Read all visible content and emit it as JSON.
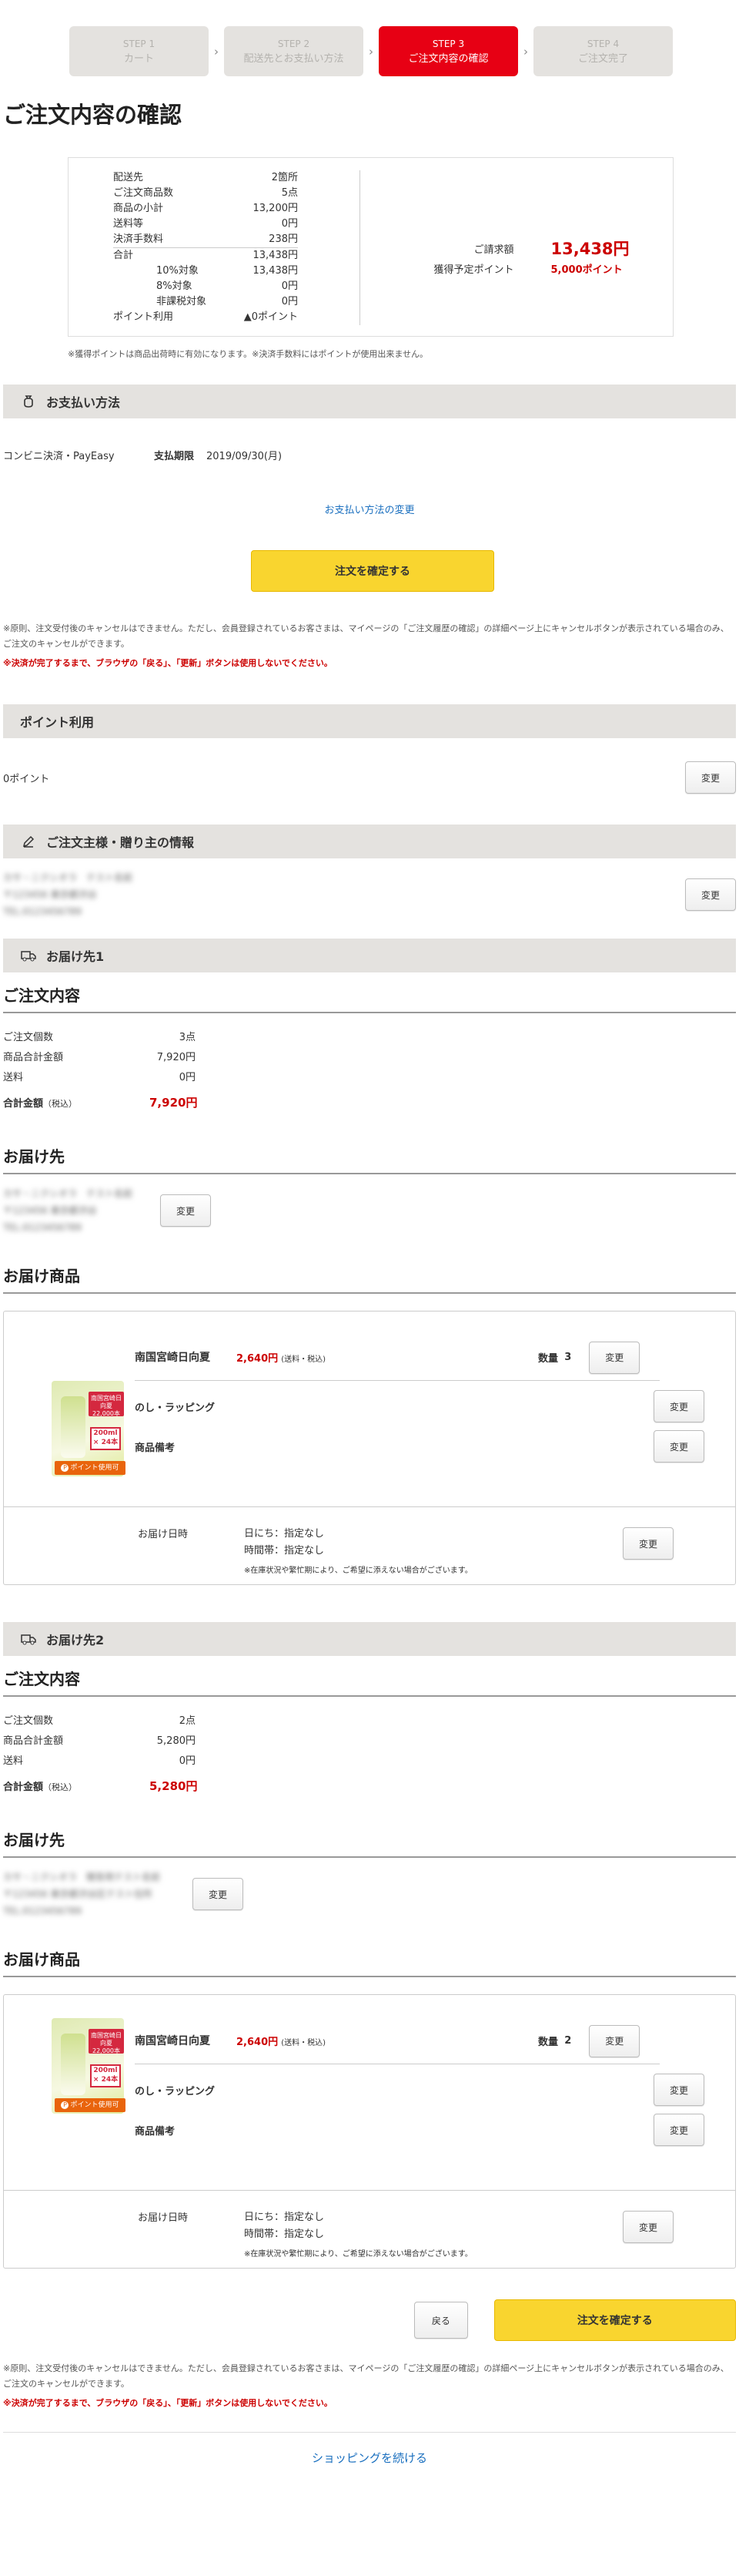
{
  "steps": [
    {
      "num": "STEP 1",
      "label": "カート"
    },
    {
      "num": "STEP 2",
      "label": "配送先とお支払い方法"
    },
    {
      "num": "STEP 3",
      "label": "ご注文内容の確認"
    },
    {
      "num": "STEP 4",
      "label": "ご注文完了"
    }
  ],
  "step_sep": "›",
  "page_title": "ご注文内容の確認",
  "summary": {
    "rows": [
      {
        "k": "配送先",
        "v": "2箇所"
      },
      {
        "k": "ご注文商品数",
        "v": "5点"
      },
      {
        "k": "商品の小計",
        "v": "13,200円"
      },
      {
        "k": "送料等",
        "v": "0円"
      },
      {
        "k": "決済手数料",
        "v": "238円"
      },
      {
        "k": "合計",
        "v": "13,438円"
      },
      {
        "k": "10%対象",
        "v": "13,438円"
      },
      {
        "k": "8%対象",
        "v": "0円"
      },
      {
        "k": "非課税対象",
        "v": "0円"
      },
      {
        "k": "ポイント利用",
        "v": "▲0ポイント"
      }
    ],
    "billing_label": "ご請求額",
    "billing_value": "13,438円",
    "points_label": "獲得予定ポイント",
    "points_value": "5,000ポイント"
  },
  "summary_note": "※獲得ポイントは商品出荷時に有効になります。※決済手数料にはポイントが使用出来ません。",
  "payment": {
    "title": "お支払い方法",
    "method": "コンビニ決済・PayEasy",
    "deadline_label": "支払期限",
    "deadline_value": "2019/09/30(月)",
    "change_link": "お支払い方法の変更",
    "confirm_button": "注文を確定する",
    "note": "※原則、注文受付後のキャンセルはできません。ただし、会員登録されているお客さまは、マイページの「ご注文履歴の確認」の詳細ページ上にキャンセルボタンが表示されている場合のみ、ご注文のキャンセルができます。",
    "warning": "※決済が完了するまで、ブラウザの「戻る」、「更新」ボタンは使用しないでください。"
  },
  "points": {
    "title": "ポイント利用",
    "value": "0ポイント",
    "change": "変更"
  },
  "orderer": {
    "title": "ご注文主様・贈り主の情報",
    "line1": "カサ・ニクシオラ　テスト名前",
    "line2": "〒123456 東京都渋谷",
    "line3": "TEL:0123456789",
    "change": "変更"
  },
  "deliveries": [
    {
      "title": "お届け先1",
      "contents_title": "ご注文内容",
      "rows": [
        {
          "k": "ご注文個数",
          "v": "3点"
        },
        {
          "k": "商品合計金額",
          "v": "7,920円"
        },
        {
          "k": "送料",
          "v": "0円"
        }
      ],
      "total_label": "合計金額",
      "total_tax": "（税込）",
      "total_value": "7,920円",
      "addr_title": "お届け先",
      "addr": [
        "カサ・ニクシオラ　テスト名前",
        "〒123456 東京都渋谷",
        "TEL:0123456789"
      ],
      "items_title": "お届け商品",
      "product": {
        "name": "南国宮崎日向夏",
        "price": "2,640円",
        "price_note": "(送料・税込)",
        "qty_label": "数量",
        "qty": "3",
        "noshi": "のし・ラッピング",
        "remarks": "商品備考",
        "img_tag": "南国宮崎日向夏 22,000本",
        "img_vol": "200ml × 24本",
        "img_pt": "ポイント使用可"
      },
      "date_label": "お届け日時",
      "date_day": "日にち：指定なし",
      "date_time": "時間帯：指定なし",
      "date_note": "※在庫状況や繁忙期により、ご希望に添えない場合がございます。",
      "change": "変更"
    },
    {
      "title": "お届け先2",
      "contents_title": "ご注文内容",
      "rows": [
        {
          "k": "ご注文個数",
          "v": "2点"
        },
        {
          "k": "商品合計金額",
          "v": "5,280円"
        },
        {
          "k": "送料",
          "v": "0円"
        }
      ],
      "total_label": "合計金額",
      "total_tax": "（税込）",
      "total_value": "5,280円",
      "addr_title": "お届け先",
      "addr": [
        "カサ・ニクシオラ　贈答用テスト名前",
        "〒123456 東京都渋谷区テスト住所",
        "TEL:0123456789"
      ],
      "items_title": "お届け商品",
      "product": {
        "name": "南国宮崎日向夏",
        "price": "2,640円",
        "price_note": "(送料・税込)",
        "qty_label": "数量",
        "qty": "2",
        "noshi": "のし・ラッピング",
        "remarks": "商品備考",
        "img_tag": "南国宮崎日向夏 22,000本",
        "img_vol": "200ml × 24本",
        "img_pt": "ポイント使用可"
      },
      "date_label": "お届け日時",
      "date_day": "日にち：指定なし",
      "date_time": "時間帯：指定なし",
      "date_note": "※在庫状況や繁忙期により、ご希望に添えない場合がございます。",
      "change": "変更"
    }
  ],
  "footer": {
    "back": "戻る",
    "confirm": "注文を確定する",
    "continue": "ショッピングを続ける"
  },
  "colors": {
    "accent": "#e70014",
    "price": "#cc0000",
    "button_yellow": "#f9d52f",
    "link": "#1a6fbf"
  }
}
